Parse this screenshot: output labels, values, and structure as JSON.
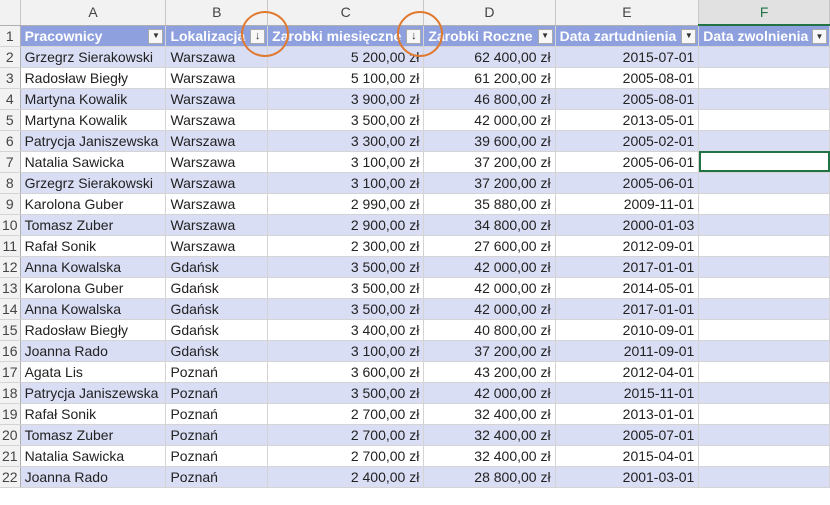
{
  "column_letters": [
    "A",
    "B",
    "C",
    "D",
    "E",
    "F"
  ],
  "headers": [
    "Pracownicy",
    "Lokalizacja",
    "Zarobki miesięczne",
    "Zarobki Roczne",
    "Data zartudnienia",
    "Data zwolnienia"
  ],
  "rows": [
    [
      "Grzegrz Sierakowski",
      "Warszawa",
      "5 200,00 zł",
      "62 400,00 zł",
      "2015-07-01",
      ""
    ],
    [
      "Radosław Biegły",
      "Warszawa",
      "5 100,00 zł",
      "61 200,00 zł",
      "2005-08-01",
      ""
    ],
    [
      "Martyna Kowalik",
      "Warszawa",
      "3 900,00 zł",
      "46 800,00 zł",
      "2005-08-01",
      ""
    ],
    [
      "Martyna Kowalik",
      "Warszawa",
      "3 500,00 zł",
      "42 000,00 zł",
      "2013-05-01",
      ""
    ],
    [
      "Patrycja Janiszewska",
      "Warszawa",
      "3 300,00 zł",
      "39 600,00 zł",
      "2005-02-01",
      ""
    ],
    [
      "Natalia Sawicka",
      "Warszawa",
      "3 100,00 zł",
      "37 200,00 zł",
      "2005-06-01",
      ""
    ],
    [
      "Grzegrz Sierakowski",
      "Warszawa",
      "3 100,00 zł",
      "37 200,00 zł",
      "2005-06-01",
      ""
    ],
    [
      "Karolona Guber",
      "Warszawa",
      "2 990,00 zł",
      "35 880,00 zł",
      "2009-11-01",
      ""
    ],
    [
      "Tomasz Zuber",
      "Warszawa",
      "2 900,00 zł",
      "34 800,00 zł",
      "2000-01-03",
      ""
    ],
    [
      "Rafał Sonik",
      "Warszawa",
      "2 300,00 zł",
      "27 600,00 zł",
      "2012-09-01",
      ""
    ],
    [
      "Anna Kowalska",
      "Gdańsk",
      "3 500,00 zł",
      "42 000,00 zł",
      "2017-01-01",
      ""
    ],
    [
      "Karolona Guber",
      "Gdańsk",
      "3 500,00 zł",
      "42 000,00 zł",
      "2014-05-01",
      ""
    ],
    [
      "Anna Kowalska",
      "Gdańsk",
      "3 500,00 zł",
      "42 000,00 zł",
      "2017-01-01",
      ""
    ],
    [
      "Radosław Biegły",
      "Gdańsk",
      "3 400,00 zł",
      "40 800,00 zł",
      "2010-09-01",
      ""
    ],
    [
      "Joanna Rado",
      "Gdańsk",
      "3 100,00 zł",
      "37 200,00 zł",
      "2011-09-01",
      ""
    ],
    [
      "Agata Lis",
      "Poznań",
      "3 600,00 zł",
      "43 200,00 zł",
      "2012-04-01",
      ""
    ],
    [
      "Patrycja Janiszewska",
      "Poznań",
      "3 500,00 zł",
      "42 000,00 zł",
      "2015-11-01",
      ""
    ],
    [
      "Rafał Sonik",
      "Poznań",
      "2 700,00 zł",
      "32 400,00 zł",
      "2013-01-01",
      ""
    ],
    [
      "Tomasz Zuber",
      "Poznań",
      "2 700,00 zł",
      "32 400,00 zł",
      "2005-07-01",
      ""
    ],
    [
      "Natalia Sawicka",
      "Poznań",
      "2 700,00 zł",
      "32 400,00 zł",
      "2015-04-01",
      ""
    ],
    [
      "Joanna Rado",
      "Poznań",
      "2 400,00 zł",
      "28 800,00 zł",
      "2001-03-01",
      ""
    ]
  ],
  "filter_icons": {
    "default": "▼",
    "sorted": "↓"
  },
  "colors": {
    "header_fill": "#8ea0de",
    "band_fill": "#d9def5",
    "selection": "#217346",
    "highlight_circle": "#e07a30"
  }
}
